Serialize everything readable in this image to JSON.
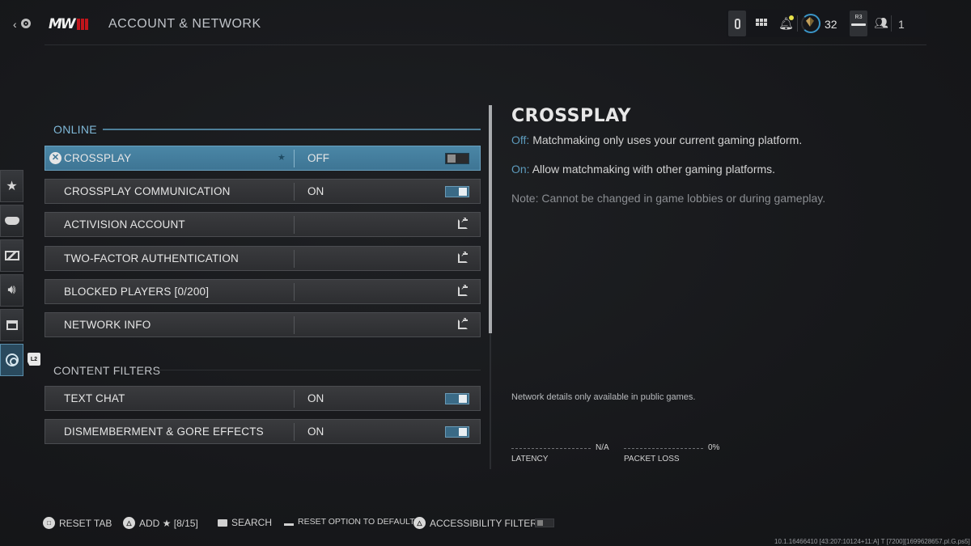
{
  "header": {
    "back_glyph": "‹",
    "logo_text": "MW",
    "title": "ACCOUNT & NETWORK"
  },
  "topbar": {
    "icons": [
      "controller-battery-icon",
      "grid-menu-icon",
      "notification-bell-icon",
      "rank-emblem-icon",
      "r3-button-icon",
      "party-icon"
    ],
    "rank_level": "32",
    "r3_label": "R3",
    "party_count": "1",
    "notification_dot_color": "#e8e24a"
  },
  "sidebar": {
    "tabs": [
      {
        "name": "favorites",
        "glyph": "★"
      },
      {
        "name": "controller",
        "glyph": "🎮"
      },
      {
        "name": "graphics",
        "glyph": "▰"
      },
      {
        "name": "audio",
        "glyph": "🔊"
      },
      {
        "name": "interface",
        "glyph": "▤"
      },
      {
        "name": "account-network",
        "glyph": "📡",
        "active": true
      }
    ],
    "l2_label": "L2"
  },
  "sections": [
    {
      "title": "ONLINE",
      "rows": [
        {
          "label": "CROSSPLAY",
          "value": "OFF",
          "control": "toggle",
          "state": "off",
          "selected": true
        },
        {
          "label": "CROSSPLAY COMMUNICATION",
          "value": "ON",
          "control": "toggle",
          "state": "on"
        },
        {
          "label": "ACTIVISION ACCOUNT",
          "value": "",
          "control": "external-link"
        },
        {
          "label": "TWO-FACTOR AUTHENTICATION",
          "value": "",
          "control": "external-link"
        },
        {
          "label": "BLOCKED PLAYERS [0/200]",
          "value": "",
          "control": "external-link"
        },
        {
          "label": "NETWORK INFO",
          "value": "",
          "control": "external-link"
        }
      ]
    },
    {
      "title": "CONTENT FILTERS",
      "rows": [
        {
          "label": "TEXT CHAT",
          "value": "ON",
          "control": "toggle",
          "state": "on"
        },
        {
          "label": "DISMEMBERMENT & GORE EFFECTS",
          "value": "ON",
          "control": "toggle",
          "state": "on"
        }
      ]
    }
  ],
  "info_panel": {
    "title": "CROSSPLAY",
    "off_key": "Off:",
    "off_text": " Matchmaking only uses your current gaming platform.",
    "on_key": "On:",
    "on_text": " Allow matchmaking with other gaming platforms.",
    "note": "Note: Cannot be changed in game lobbies or during gameplay.",
    "network_note": "Network details only available in public games.",
    "stats": [
      {
        "label": "LATENCY",
        "value": "N/A"
      },
      {
        "label": "PACKET LOSS",
        "value": "0%"
      }
    ]
  },
  "footer": {
    "reset_tab": "RESET TAB",
    "add_favorite": "ADD ★ [8/15]",
    "search": "SEARCH",
    "reset_option": "RESET OPTION TO DEFAULT",
    "accessibility_filter": "ACCESSIBILITY FILTER",
    "accessibility_filter_state": "off",
    "build_string": "10.1.16466410 [43:207:10124+11:A] T [7200][1699628657.pl.G.ps5]"
  },
  "colors": {
    "accent_blue": "#4a86a6",
    "section_blue": "#7fb8d8",
    "key_blue": "#5d9bbd",
    "logo_red": "#c0151b"
  }
}
